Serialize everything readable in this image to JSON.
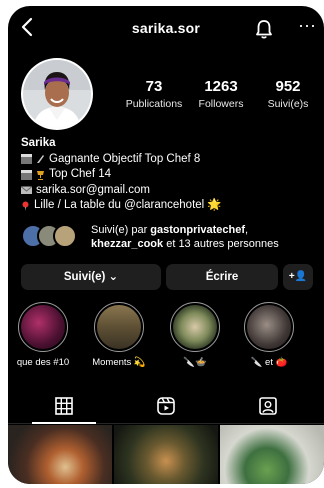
{
  "header": {
    "username": "sarika.sor",
    "back_icon": "chevron-left-icon",
    "bell_icon": "bell-icon",
    "more_icon": "more-horizontal-icon"
  },
  "stats": {
    "posts": {
      "value": "73",
      "label": "Publications"
    },
    "followers": {
      "value": "1263",
      "label": "Followers"
    },
    "following": {
      "value": "952",
      "label": "Suivi(e)s"
    }
  },
  "bio": {
    "name": "Sarika",
    "line1": "Gagnante Objectif Top Chef 8",
    "line2": "Top Chef 14",
    "email": "sarika.sor@gmail.com",
    "location": "Lille / La table du @clarancehotel 🌟"
  },
  "followed_by": {
    "prefix": "Suivi(e) par ",
    "user1": "gastonprivatechef",
    "separator": ",",
    "user2": "khezzar_cook",
    "suffix": " et 13 autres personnes"
  },
  "buttons": {
    "follow": "Suivi(e) ⌄",
    "message": "Écrire",
    "add": "+👤"
  },
  "highlights": [
    {
      "caption": "que des #10"
    },
    {
      "caption": "Moments 💫"
    },
    {
      "caption": "🔪🍲"
    },
    {
      "caption": "🔪 et 🍅"
    }
  ],
  "tabs": [
    "grid-icon",
    "reels-icon",
    "tagged-icon"
  ],
  "colors": {
    "background": "#000000",
    "button": "#1f1f1f",
    "divider": "#262626"
  }
}
